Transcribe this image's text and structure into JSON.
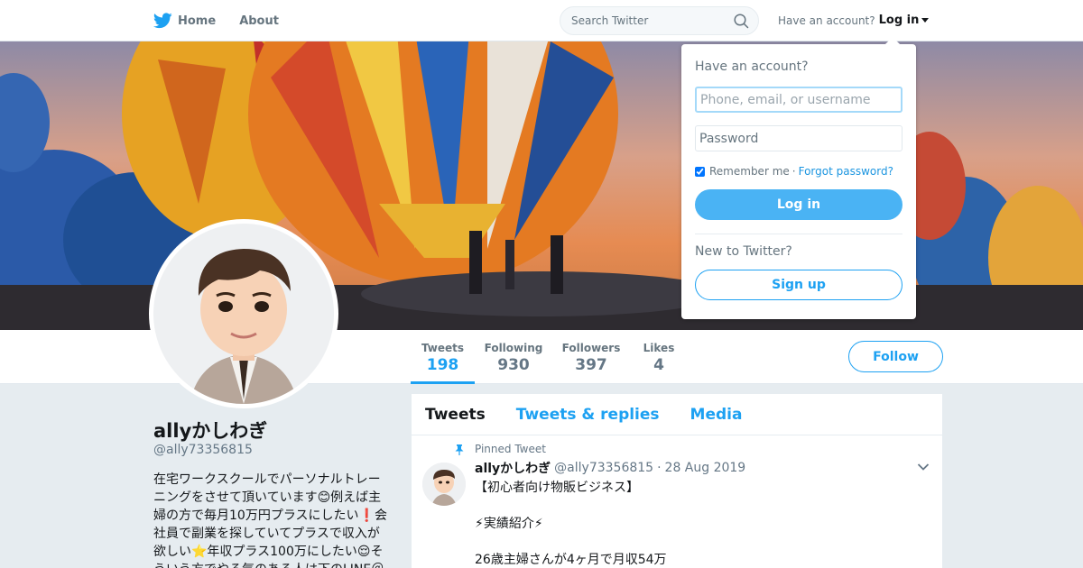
{
  "nav": {
    "home_label": "Home",
    "about_label": "About",
    "home_icon": "twitter-bird-icon",
    "search_placeholder": "Search Twitter",
    "have_account": "Have an account?",
    "login_label": "Log in"
  },
  "profile": {
    "name": "allyかしわぎ",
    "handle": "@ally73356815",
    "bio": "在宅ワークスクールでパーソナルトレーニングをさせて頂いています😊例えば主婦の方で毎月10万円プラスにしたい❗️会社員で副業を探していてプラスで収入が欲しい⭐年収プラス100万にしたい😌そういう方でやる気のある人は下のLINE＠"
  },
  "stats": [
    {
      "label": "Tweets",
      "value": "198"
    },
    {
      "label": "Following",
      "value": "930"
    },
    {
      "label": "Followers",
      "value": "397"
    },
    {
      "label": "Likes",
      "value": "4"
    }
  ],
  "follow_label": "Follow",
  "timeline": {
    "tabs": [
      "Tweets",
      "Tweets & replies",
      "Media"
    ],
    "tweet": {
      "pinned_label": "Pinned Tweet",
      "name": "allyかしわぎ",
      "handle": "@ally73356815",
      "separator": "·",
      "date": "28 Aug 2019",
      "lines": [
        "【初心者向け物販ビジネス】",
        "",
        "⚡実績紹介⚡",
        "",
        "26歳主婦さんが4ヶ月で月収54万"
      ]
    }
  },
  "login_dropdown": {
    "title": "Have an account?",
    "username_placeholder": "Phone, email, or username",
    "password_placeholder": "Password",
    "remember_label": "Remember me",
    "separator": "·",
    "forgot_label": "Forgot password?",
    "login_button": "Log in",
    "new_label": "New to Twitter?",
    "signup_button": "Sign up"
  },
  "colors": {
    "accent": "#1da1f2",
    "login_button": "#4ab3f4",
    "background": "#e6ecf0"
  }
}
